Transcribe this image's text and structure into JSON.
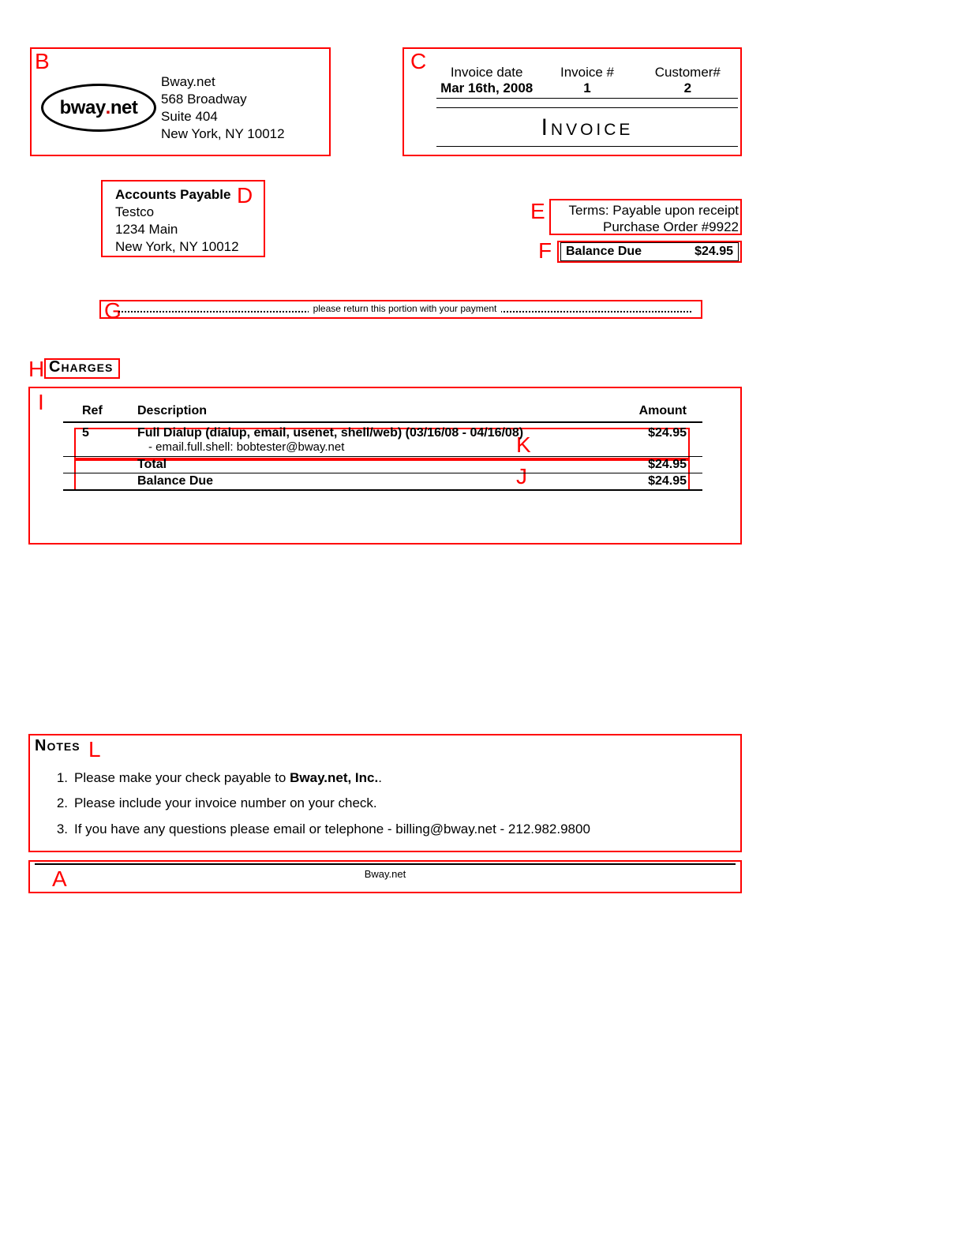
{
  "region_tags": {
    "A": "A",
    "B": "B",
    "C": "C",
    "D": "D",
    "E": "E",
    "F": "F",
    "G": "G",
    "H": "H",
    "I": "I",
    "J": "J",
    "K": "K",
    "L": "L"
  },
  "company": {
    "logo_text_pre": "bway",
    "logo_dot": ".",
    "logo_text_post": "net",
    "name": "Bway.net",
    "addr1": "568 Broadway",
    "addr2": "Suite 404",
    "addr3": "New York, NY  10012"
  },
  "invoice_meta": {
    "labels": {
      "date": "Invoice date",
      "num": "Invoice #",
      "cust": "Customer#"
    },
    "values": {
      "date": "Mar 16th, 2008",
      "num": "1",
      "cust": "2"
    },
    "title": "Invoice"
  },
  "bill_to": {
    "heading": "Accounts Payable",
    "name": "Testco",
    "addr1": "1234 Main",
    "addr2": "New York, NY  10012"
  },
  "terms": {
    "line1": "Terms: Payable upon receipt",
    "line2": "Purchase Order #9922"
  },
  "balance_top": {
    "label": "Balance Due",
    "amount": "$24.95"
  },
  "tear_text": "please return this portion with your payment",
  "sections": {
    "charges": "Charges",
    "notes": "Notes"
  },
  "charges": {
    "headers": {
      "ref": "Ref",
      "desc": "Description",
      "amount": "Amount"
    },
    "row": {
      "ref": "5",
      "desc": "Full Dialup (dialup, email, usenet, shell/web) (03/16/08 - 04/16/08)",
      "detail": "- email.full.shell: bobtester@bway.net",
      "amount": "$24.95"
    },
    "total": {
      "label": "Total",
      "amount": "$24.95"
    },
    "balance": {
      "label": "Balance Due",
      "amount": "$24.95"
    }
  },
  "notes": {
    "n1_pre": "Please make your check payable to ",
    "n1_bold": "Bway.net, Inc.",
    "n1_post": ".",
    "n2": "Please include your invoice number on your check.",
    "n3": "If you have any questions please email or telephone - billing@bway.net - 212.982.9800"
  },
  "footer": "Bway.net"
}
